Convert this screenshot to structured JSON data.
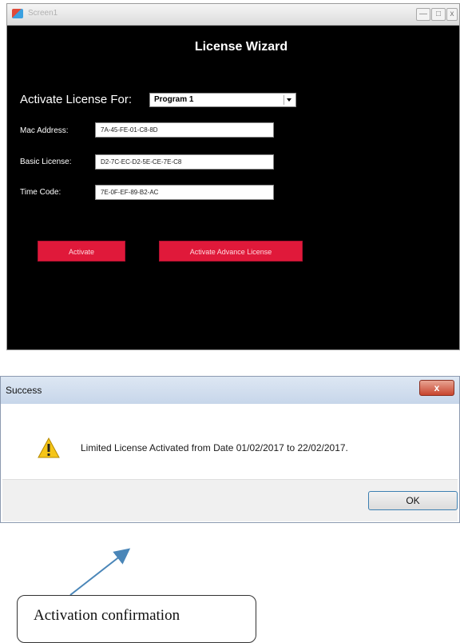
{
  "wizard": {
    "window_title": "Screen1",
    "controls": {
      "minimize": "—",
      "maximize": "□",
      "close": "x"
    },
    "heading": "License Wizard",
    "activate_for_label": "Activate License For:",
    "program_selected": "Program 1",
    "mac_label": "Mac Address:",
    "mac_value": "7A-45-FE-01-C8-8D",
    "basic_label": "Basic License:",
    "basic_value": "D2-7C-EC-D2-5E-CE-7E-C8",
    "time_label": "Time Code:",
    "time_value": "7E-0F-EF-89-B2-AC",
    "activate_button": "Activate",
    "advance_button": "Activate Advance License",
    "accent_color": "#e0193a"
  },
  "dialog": {
    "title": "Success",
    "close_glyph": "x",
    "icon": "warning-icon",
    "message": "Limited License Activated from Date 01/02/2017 to 22/02/2017.",
    "ok_button": "OK"
  },
  "annotation": {
    "callout_text": "Activation confirmation"
  }
}
